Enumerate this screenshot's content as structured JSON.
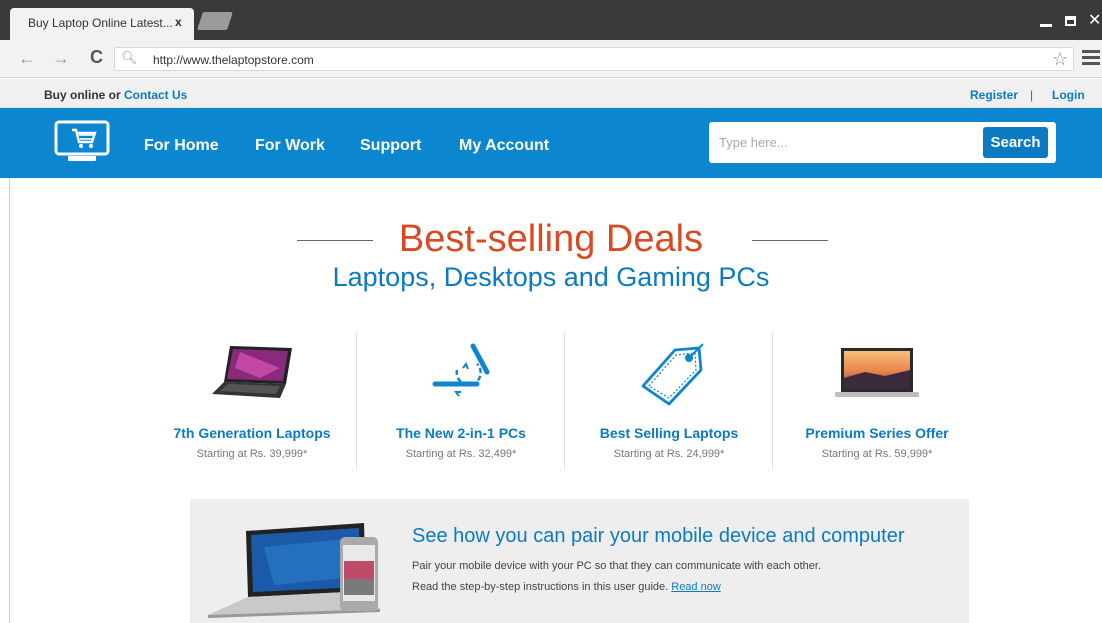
{
  "browser": {
    "tab_title": "Buy Laptop Online Latest...",
    "tab_close": "x",
    "url": "http://www.thelaptopstore.com"
  },
  "topstrip": {
    "buy_online": "Buy online or ",
    "contact_us": "Contact Us",
    "register": "Register",
    "separator": "|",
    "login": "Login"
  },
  "nav": {
    "links": [
      "For Home",
      "For Work",
      "Support",
      "My Account"
    ],
    "search_placeholder": "Type here...",
    "search_button": "Search"
  },
  "hero": {
    "title": "Best-selling Deals",
    "subtitle": "Laptops, Desktops and Gaming PCs"
  },
  "products": [
    {
      "title": "7th Generation Laptops",
      "price": "Starting at Rs. 39,999*",
      "icon": "laptop-image"
    },
    {
      "title": "The New 2-in-1 PCs",
      "price": "Starting at Rs. 32,499*",
      "icon": "2-in-1-icon"
    },
    {
      "title": "Best Selling Laptops",
      "price": "Starting at Rs. 24,999*",
      "icon": "price-tag-icon"
    },
    {
      "title": "Premium Series Offer",
      "price": "Starting at Rs. 59,999*",
      "icon": "premium-laptop-image"
    }
  ],
  "banner": {
    "title": "See how you can pair your mobile device and computer",
    "text1": "Pair your mobile device with your PC so that they can communicate with each other.",
    "text2": "Read the step-by-step instructions in this user guide. ",
    "link": "Read now"
  },
  "colors": {
    "brand_blue": "#0b86cf",
    "link_blue": "#0b7ac2",
    "headline_red": "#d84a24"
  }
}
